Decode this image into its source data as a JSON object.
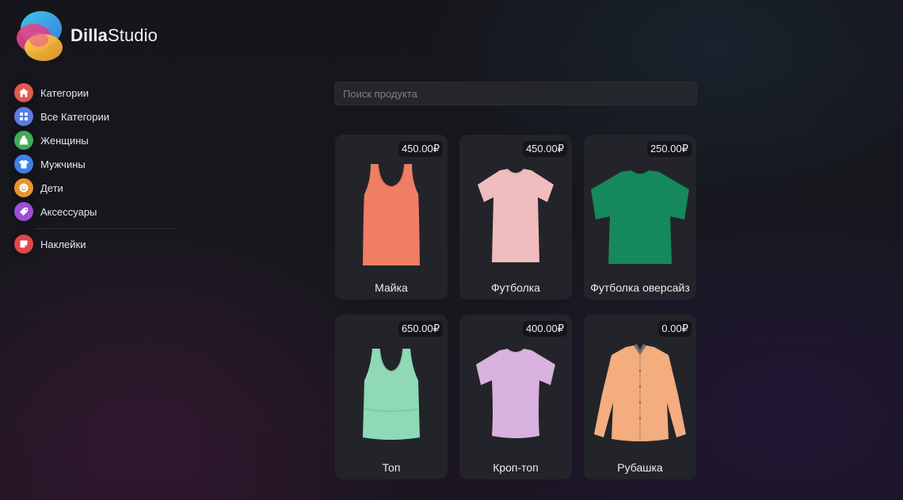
{
  "brand": {
    "name_bold": "Dilla",
    "name_regular": "Studio"
  },
  "sidebar": {
    "items": [
      {
        "label": "Категории",
        "icon": "home-icon",
        "color": "#e05a4f"
      },
      {
        "label": "Все Категории",
        "icon": "grid-icon",
        "color": "#5b7be6"
      },
      {
        "label": "Женщины",
        "icon": "dress-icon",
        "color": "#3fae5a"
      },
      {
        "label": "Мужчины",
        "icon": "tshirt-icon",
        "color": "#3f82e6"
      },
      {
        "label": "Дети",
        "icon": "smiley-icon",
        "color": "#e8942f"
      },
      {
        "label": "Аксессуары",
        "icon": "tag-icon",
        "color": "#9a4fd6"
      }
    ],
    "secondary": {
      "label": "Наклейки",
      "icon": "sticker-icon",
      "color": "#e0464a"
    }
  },
  "search": {
    "placeholder": "Поиск продукта",
    "value": ""
  },
  "products": [
    {
      "name": "Майка",
      "price": "450.00₽",
      "image": "tank-top",
      "color": "#f07e64"
    },
    {
      "name": "Футболка",
      "price": "450.00₽",
      "image": "t-shirt",
      "color": "#f1bcbd"
    },
    {
      "name": "Футболка оверсайз",
      "price": "250.00₽",
      "image": "oversize-t-shirt",
      "color": "#16895c"
    },
    {
      "name": "Топ",
      "price": "650.00₽",
      "image": "crop-tank",
      "color": "#8fd9b6"
    },
    {
      "name": "Кроп-топ",
      "price": "400.00₽",
      "image": "crop-t-shirt",
      "color": "#d9b2e0"
    },
    {
      "name": "Рубашка",
      "price": "0.00₽",
      "image": "shirt",
      "color": "#f3ad7e"
    }
  ]
}
